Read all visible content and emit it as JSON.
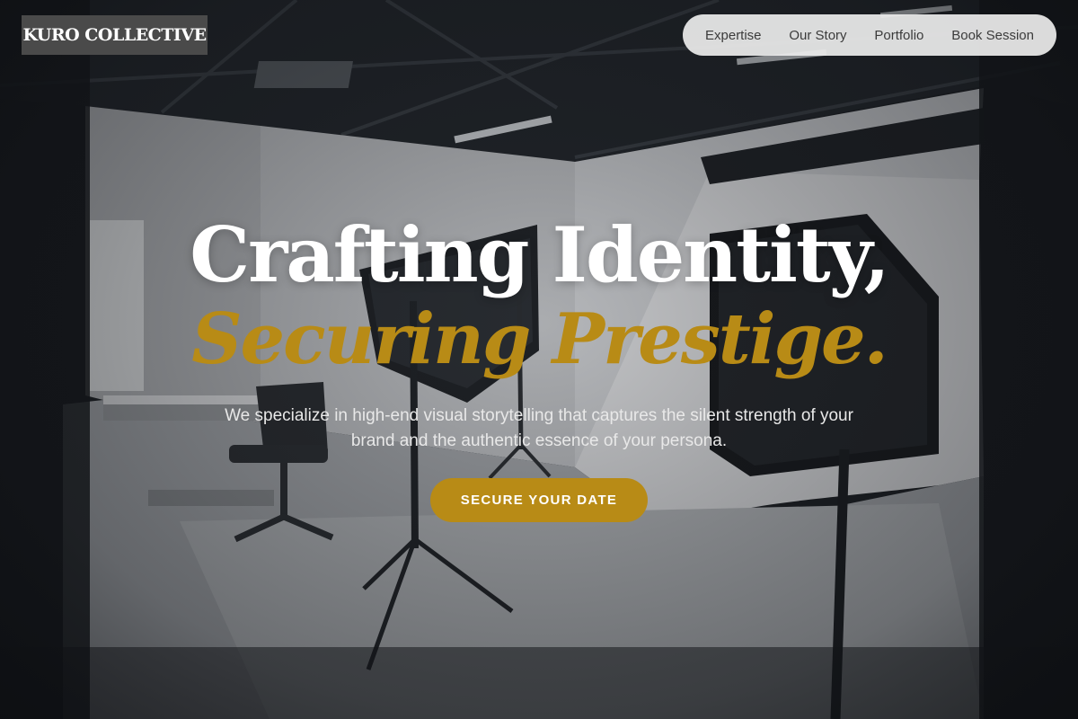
{
  "brand": {
    "logo_text": "KURO COLLECTIVE"
  },
  "nav": {
    "links": [
      {
        "label": "Expertise"
      },
      {
        "label": "Our Story"
      },
      {
        "label": "Portfolio"
      },
      {
        "label": "Book Session"
      }
    ]
  },
  "hero": {
    "headline_line1": "Crafting Identity,",
    "headline_line2": "Securing Prestige.",
    "subtitle": "We specialize in high-end visual storytelling that captures the silent strength of your brand and the authentic essence of your persona.",
    "cta_label": "SECURE YOUR DATE",
    "background_image": "photo-studio-with-softbox-lights"
  },
  "colors": {
    "accent": "#b88b16",
    "nav_bg": "#ebebeb",
    "logo_bg": "#4a4a4a",
    "text_light": "#ffffff"
  }
}
